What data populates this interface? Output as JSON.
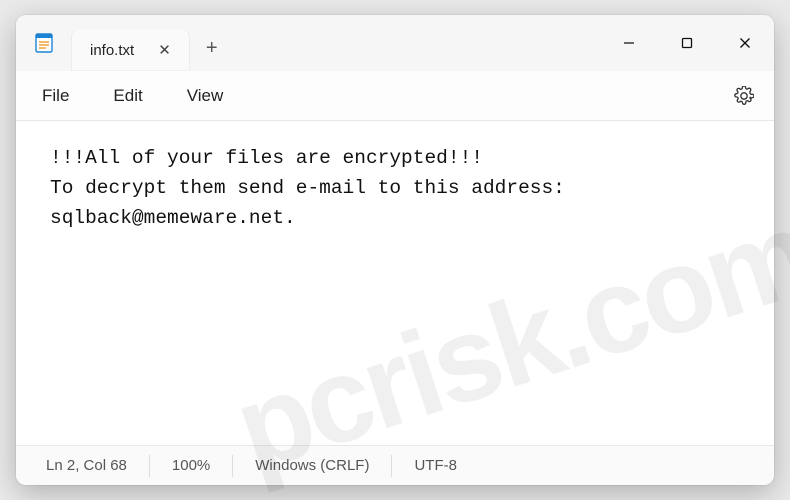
{
  "tab": {
    "title": "info.txt",
    "close_glyph": "✕"
  },
  "newtab_glyph": "+",
  "window_controls": {
    "minimize": "—",
    "maximize": "☐",
    "close": "✕"
  },
  "menu": {
    "file": "File",
    "edit": "Edit",
    "view": "View"
  },
  "content": {
    "line1": "!!!All of your files are encrypted!!!",
    "line2": "To decrypt them send e-mail to this address: sqlback@memeware.net."
  },
  "status": {
    "position": "Ln 2, Col 68",
    "zoom": "100%",
    "eol": "Windows (CRLF)",
    "encoding": "UTF-8"
  },
  "watermark": "pcrisk.com"
}
